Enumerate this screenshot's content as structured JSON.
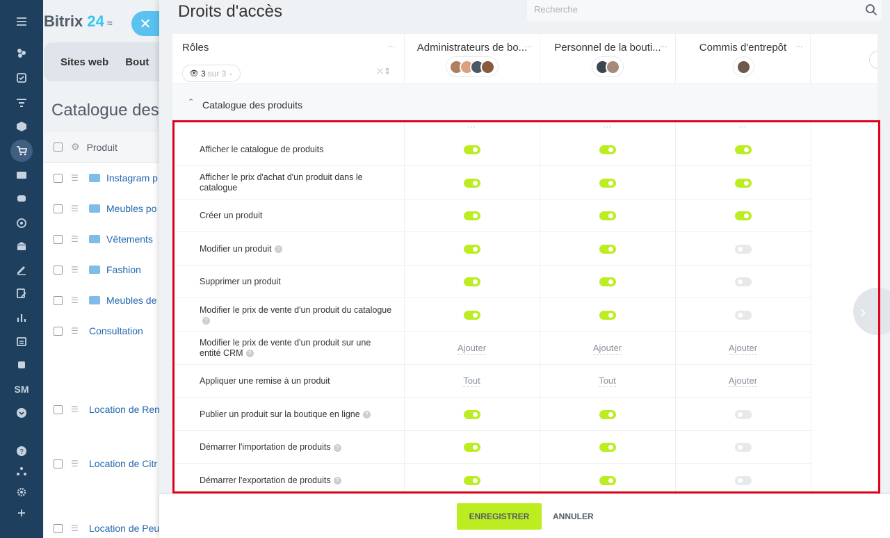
{
  "app": {
    "logo": "Bitrix",
    "logo_num": "24"
  },
  "background": {
    "tabs": [
      "Sites web",
      "Bout"
    ],
    "title": "Catalogue des",
    "table_header": "Produit",
    "rows": [
      "Instagram p",
      "Meubles po",
      "Vêtements",
      "Fashion",
      "Meubles de",
      "Consultation",
      "Location de Ren",
      "Location de Citr",
      "Location de Peu"
    ]
  },
  "rail": {
    "sm_label": "SM"
  },
  "slider": {
    "title": "Droits d'accès",
    "search_placeholder": "Recherche",
    "roles_label": "Rôles",
    "role_filter_count": "3",
    "role_filter_total": "sur 3",
    "columns": [
      {
        "name": "Administrateurs de bo..."
      },
      {
        "name": "Personnel de la bouti..."
      },
      {
        "name": "Commis d'entrepôt"
      }
    ],
    "section": "Catalogue des produits",
    "permissions": [
      {
        "label": "Afficher le catalogue de produits",
        "help": false,
        "values": [
          "on",
          "on",
          "on"
        ]
      },
      {
        "label": "Afficher le prix d'achat d'un produit dans le catalogue",
        "help": false,
        "values": [
          "on",
          "on",
          "on"
        ]
      },
      {
        "label": "Créer un produit",
        "help": false,
        "values": [
          "on",
          "on",
          "on"
        ]
      },
      {
        "label": "Modifier un produit",
        "help": true,
        "values": [
          "on",
          "on",
          "off"
        ]
      },
      {
        "label": "Supprimer un produit",
        "help": false,
        "values": [
          "on",
          "on",
          "off"
        ]
      },
      {
        "label": "Modifier le prix de vente d'un produit du catalogue",
        "help": true,
        "values": [
          "on",
          "on",
          "off"
        ]
      },
      {
        "label": "Modifier le prix de vente d'un produit sur une entité CRM",
        "help": true,
        "values": [
          "Ajouter",
          "Ajouter",
          "Ajouter"
        ]
      },
      {
        "label": "Appliquer une remise à un produit",
        "help": false,
        "values": [
          "Tout",
          "Tout",
          "Ajouter"
        ]
      },
      {
        "label": "Publier un produit sur la boutique en ligne",
        "help": true,
        "values": [
          "on",
          "on",
          "off"
        ]
      },
      {
        "label": "Démarrer l'importation de produits",
        "help": true,
        "values": [
          "on",
          "on",
          "off"
        ]
      },
      {
        "label": "Démarrer l'exportation de produits",
        "help": true,
        "values": [
          "on",
          "on",
          "off"
        ]
      }
    ],
    "save_label": "ENREGISTRER",
    "cancel_label": "ANNULER"
  },
  "colors": {
    "accent_green": "#bbed21",
    "highlight_red": "#e0001a",
    "sidebar": "#1f3f5e"
  }
}
